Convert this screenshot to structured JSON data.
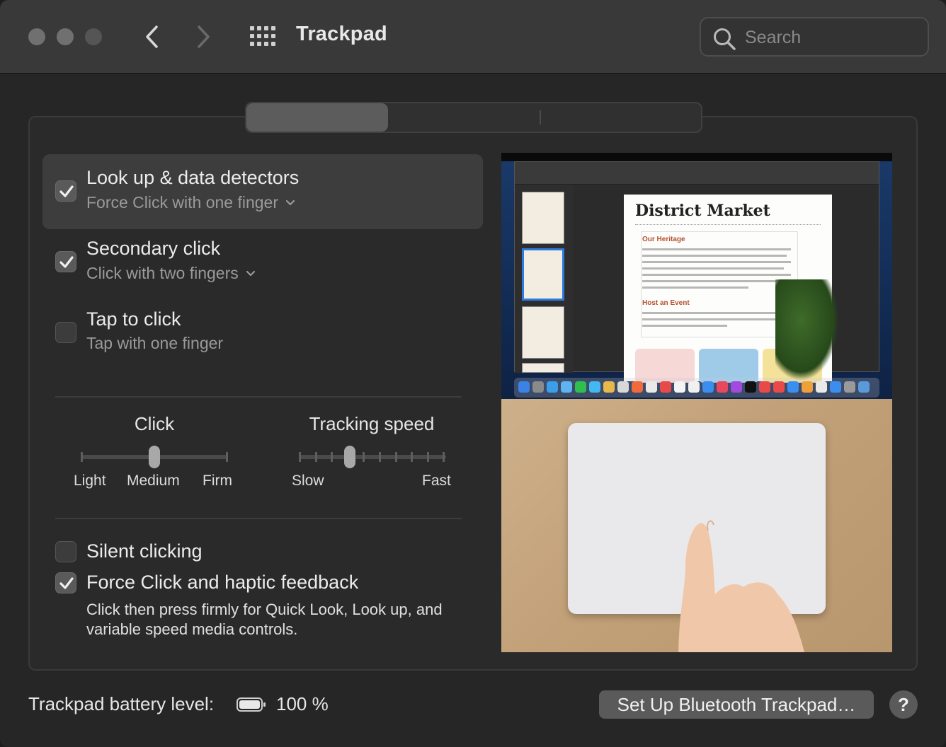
{
  "window": {
    "title": "Trackpad",
    "search_placeholder": "Search"
  },
  "options": [
    {
      "title": "Look up & data detectors",
      "subtitle": "Force Click with one finger",
      "checked": true,
      "has_dropdown": true
    },
    {
      "title": "Secondary click",
      "subtitle": "Click with two fingers",
      "checked": true,
      "has_dropdown": true
    },
    {
      "title": "Tap to click",
      "subtitle": "Tap with one finger",
      "checked": false,
      "has_dropdown": false
    }
  ],
  "sliders": {
    "click": {
      "label": "Click",
      "ticks": [
        "Light",
        "Medium",
        "Firm"
      ],
      "value": "Medium"
    },
    "tracking": {
      "label": "Tracking speed",
      "min_label": "Slow",
      "max_label": "Fast",
      "position": 0.3
    }
  },
  "bottom_options": {
    "silent": {
      "label": "Silent clicking",
      "checked": false
    },
    "force": {
      "label": "Force Click and haptic feedback",
      "checked": true,
      "description": "Click then press firmly for Quick Look, Look up, and variable speed media controls."
    }
  },
  "preview": {
    "doc_title": "District Market",
    "heading1": "Our Heritage",
    "heading2": "Host an Event"
  },
  "footer": {
    "battery_label": "Trackpad battery level:",
    "battery_value": "100 %",
    "setup_button": "Set Up Bluetooth Trackpad…",
    "help": "?"
  },
  "colors": {
    "window_bg": "#262626",
    "titlebar_bg": "#393939",
    "selected_row": "#3d3d3d",
    "button": "#5a5a5a"
  }
}
